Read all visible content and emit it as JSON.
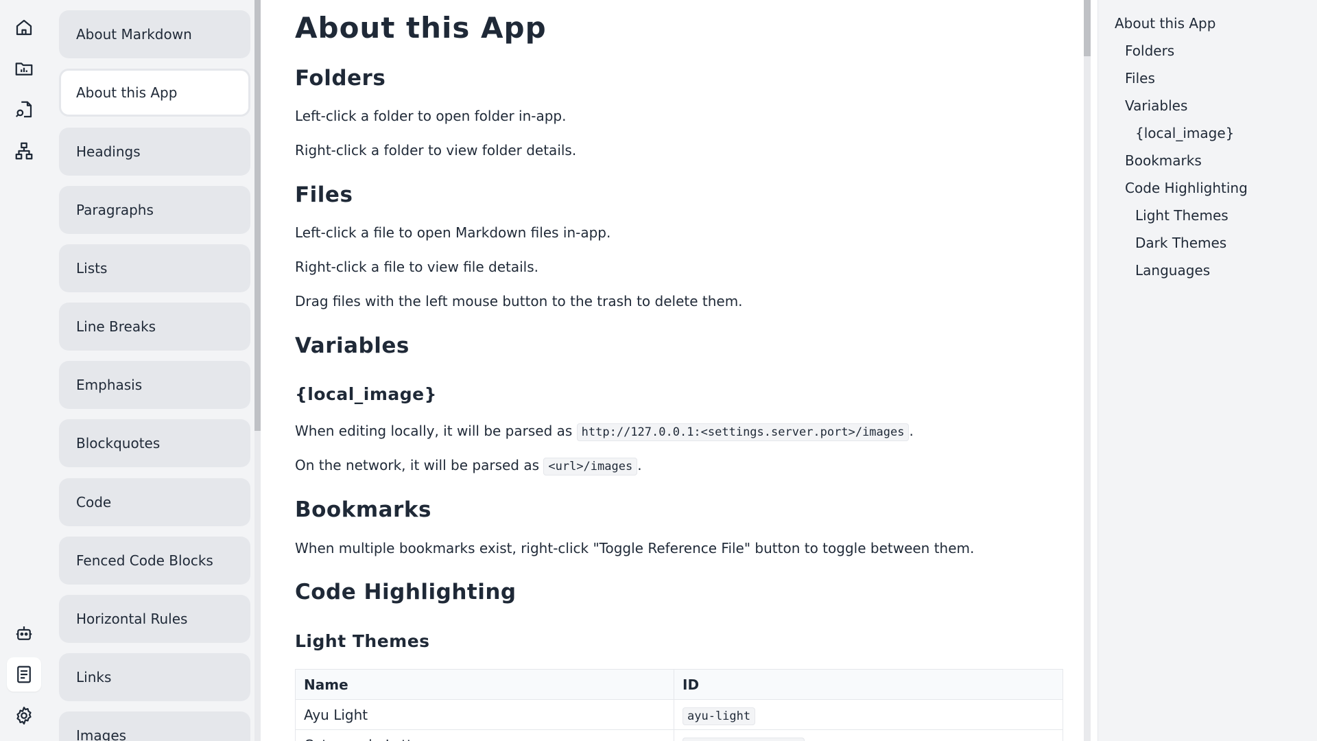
{
  "rail": {
    "top_icons": [
      "home-icon",
      "chart-folder-icon",
      "file-search-icon",
      "sitemap-icon"
    ],
    "bottom_icons": [
      "bot-icon",
      "document-icon",
      "gear-icon"
    ],
    "active_icon": "document-icon"
  },
  "doclist": {
    "items": [
      {
        "label": "About Markdown"
      },
      {
        "label": "About this App",
        "active": true
      },
      {
        "label": "Headings"
      },
      {
        "label": "Paragraphs"
      },
      {
        "label": "Lists"
      },
      {
        "label": "Line Breaks"
      },
      {
        "label": "Emphasis"
      },
      {
        "label": "Blockquotes"
      },
      {
        "label": "Code"
      },
      {
        "label": "Fenced Code Blocks"
      },
      {
        "label": "Horizontal Rules"
      },
      {
        "label": "Links"
      },
      {
        "label": "Images"
      }
    ]
  },
  "doc": {
    "title": "About this App",
    "folders": {
      "heading": "Folders",
      "p1": "Left-click a folder to open folder in-app.",
      "p2": "Right-click a folder to view folder details."
    },
    "files": {
      "heading": "Files",
      "p1": "Left-click a file to open Markdown files in-app.",
      "p2": "Right-click a file to view file details.",
      "p3": "Drag files with the left mouse button to the trash to delete them."
    },
    "variables": {
      "heading": "Variables",
      "sub": "{local_image}",
      "p1_pre": "When editing locally, it will be parsed as ",
      "p1_code": "http://127.0.0.1:<settings.server.port>/images",
      "p1_post": ".",
      "p2_pre": "On the network, it will be parsed as ",
      "p2_code": "<url>/images",
      "p2_post": "."
    },
    "bookmarks": {
      "heading": "Bookmarks",
      "p1": "When multiple bookmarks exist, right-click \"Toggle Reference File\" button to toggle between them."
    },
    "code_highlighting": {
      "heading": "Code Highlighting",
      "light_themes": {
        "heading": "Light Themes",
        "columns": [
          "Name",
          "ID"
        ],
        "rows": [
          {
            "name": "Ayu Light",
            "id": "ayu-light"
          },
          {
            "name": "Catppuccin Latte",
            "id": "catppuccin-latte"
          }
        ]
      }
    }
  },
  "toc": {
    "items": [
      {
        "label": "About this App",
        "level": 1
      },
      {
        "label": "Folders",
        "level": 2
      },
      {
        "label": "Files",
        "level": 2
      },
      {
        "label": "Variables",
        "level": 2
      },
      {
        "label": "{local_image}",
        "level": 3
      },
      {
        "label": "Bookmarks",
        "level": 2
      },
      {
        "label": "Code Highlighting",
        "level": 2
      },
      {
        "label": "Light Themes",
        "level": 3
      },
      {
        "label": "Dark Themes",
        "level": 3
      },
      {
        "label": "Languages",
        "level": 3
      }
    ]
  },
  "colors": {
    "text": "#1f2937",
    "panel": "#f3f4f6",
    "item": "#e5e7eb"
  }
}
